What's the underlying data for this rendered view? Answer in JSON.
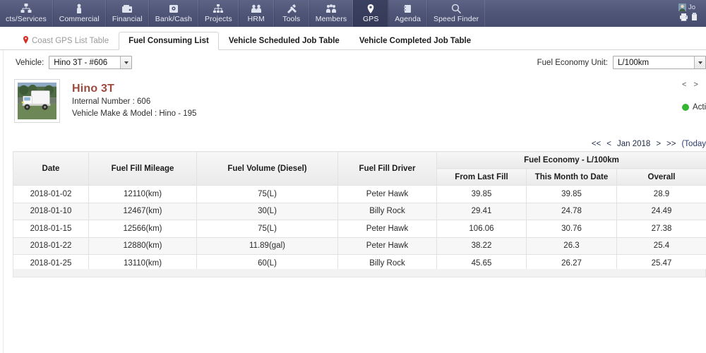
{
  "topnav": {
    "items": [
      {
        "label": "cts/Services",
        "icon": "products-services-icon",
        "active": false
      },
      {
        "label": "Commercial",
        "icon": "person-icon",
        "active": false
      },
      {
        "label": "Financial",
        "icon": "wallet-icon",
        "active": false
      },
      {
        "label": "Bank/Cash",
        "icon": "bank-icon",
        "active": false
      },
      {
        "label": "Projects",
        "icon": "sitemap-icon",
        "active": false
      },
      {
        "label": "HRM",
        "icon": "people-icon",
        "active": false
      },
      {
        "label": "Tools",
        "icon": "tools-icon",
        "active": false
      },
      {
        "label": "Members",
        "icon": "members-icon",
        "active": false
      },
      {
        "label": "GPS",
        "icon": "map-pin-icon",
        "active": true
      },
      {
        "label": "Agenda",
        "icon": "agenda-icon",
        "active": false
      },
      {
        "label": "Speed Finder",
        "icon": "search-icon",
        "active": false
      }
    ],
    "user_label": "Jo",
    "print_icon": "printer-icon"
  },
  "tabs": [
    {
      "label": "Coast GPS List Table",
      "icon": "map-pin-icon",
      "active": false,
      "muted": true
    },
    {
      "label": "Fuel Consuming List",
      "icon": null,
      "active": true,
      "muted": false
    },
    {
      "label": "Vehicle Scheduled Job Table",
      "icon": null,
      "active": false,
      "muted": false
    },
    {
      "label": "Vehicle Completed Job Table",
      "icon": null,
      "active": false,
      "muted": false
    }
  ],
  "filters": {
    "vehicle_label": "Vehicle:",
    "vehicle_value": "Hino 3T - #606",
    "unit_label": "Fuel Economy Unit:",
    "unit_value": "L/100km"
  },
  "vehicle_card": {
    "thumb_icon": "truck-photo",
    "title": "Hino 3T",
    "internal_number": "Internal Number : 606",
    "make_model": "Vehicle Make & Model : Hino - 195",
    "prev_arrow": "<",
    "next_arrow": ">",
    "status": "Active",
    "status_color": "#35b633"
  },
  "pager": {
    "first": "<<",
    "prev": "<",
    "label": "Jan 2018",
    "next": ">",
    "last": ">>",
    "today": "(Today"
  },
  "table": {
    "group_header": "Fuel Economy - L/100km",
    "columns": [
      "Date",
      "Fuel Fill Mileage",
      "Fuel Volume (Diesel)",
      "Fuel Fill Driver"
    ],
    "sub_columns": [
      "From Last Fill",
      "This Month to Date",
      "Overall"
    ],
    "rows": [
      {
        "date": "2018-01-02",
        "mileage": "12110(km)",
        "volume": "75(L)",
        "driver": "Peter Hawk",
        "from_last_fill": "39.85",
        "month_to_date": "39.85",
        "overall": "28.9"
      },
      {
        "date": "2018-01-10",
        "mileage": "12467(km)",
        "volume": "30(L)",
        "driver": "Billy Rock",
        "from_last_fill": "29.41",
        "month_to_date": "24.78",
        "overall": "24.49"
      },
      {
        "date": "2018-01-15",
        "mileage": "12566(km)",
        "volume": "75(L)",
        "driver": "Peter Hawk",
        "from_last_fill": "106.06",
        "month_to_date": "30.76",
        "overall": "27.38"
      },
      {
        "date": "2018-01-22",
        "mileage": "12880(km)",
        "volume": "11.89(gal)",
        "driver": "Peter Hawk",
        "from_last_fill": "38.22",
        "month_to_date": "26.3",
        "overall": "25.4"
      },
      {
        "date": "2018-01-25",
        "mileage": "13110(km)",
        "volume": "60(L)",
        "driver": "Billy Rock",
        "from_last_fill": "45.65",
        "month_to_date": "26.27",
        "overall": "25.47"
      }
    ]
  },
  "colors": {
    "nav_bg": "#4e5475",
    "nav_active": "#3b4060",
    "title_red": "#9c4a3d",
    "link_blue": "#2f3fa8",
    "status_green": "#35b633"
  }
}
